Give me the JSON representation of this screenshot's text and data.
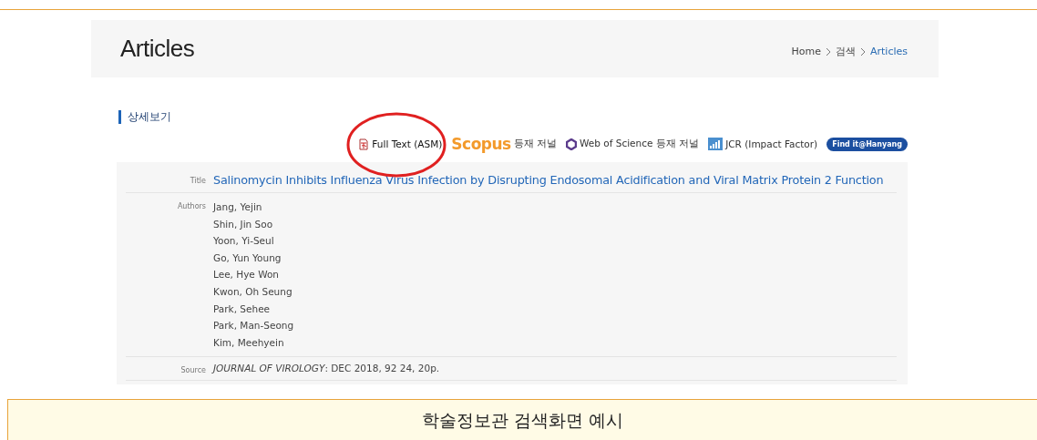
{
  "page": {
    "title": "Articles",
    "breadcrumb": [
      {
        "label": "Home",
        "current": false
      },
      {
        "label": "검색",
        "current": false
      },
      {
        "label": "Articles",
        "current": true
      }
    ]
  },
  "section_title": "상세보기",
  "links": [
    {
      "kind": "fulltext",
      "label": "Full Text (ASM)",
      "highlighted": true
    },
    {
      "kind": "scopus",
      "brand": "Scopus",
      "label": "등재 저널",
      "highlighted": false
    },
    {
      "kind": "wos",
      "label": "Web of Science 등재 저널",
      "highlighted": false
    },
    {
      "kind": "jcr",
      "label": "JCR (Impact Factor)",
      "highlighted": false
    },
    {
      "kind": "findit",
      "label": "Find it@Hanyang",
      "highlighted": false
    }
  ],
  "record": {
    "title_label": "Title",
    "title": "Salinomycin Inhibits Influenza Virus Infection by Disrupting Endosomal Acidification and Viral Matrix Protein 2 Function",
    "authors_label": "Authors",
    "authors": [
      "Jang, Yejin",
      "Shin, Jin Soo",
      "Yoon, Yi-Seul",
      "Go, Yun Young",
      "Lee, Hye Won",
      "Kwon, Oh Seung",
      "Park, Sehee",
      "Park, Man-Seong",
      "Kim, Meehyein"
    ],
    "source_label": "Source",
    "source": "*JOURNAL OF VIROLOGY*: DEC 2018, 92 24, 20p."
  },
  "caption": "학술정보관 검색화면 예시"
}
